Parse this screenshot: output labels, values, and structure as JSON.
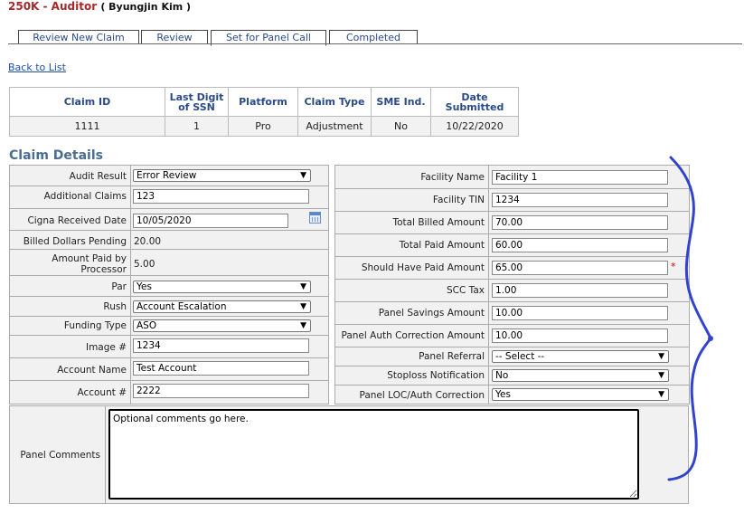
{
  "header": {
    "title": "250K - Auditor",
    "user": "( Byungjin Kim )"
  },
  "tabs": [
    "Review New Claim",
    "Review",
    "Set for Panel Call",
    "Completed"
  ],
  "back_link": "Back to List",
  "summary": {
    "headers": [
      "Claim ID",
      "Last Digit of SSN",
      "Platform",
      "Claim Type",
      "SME Ind.",
      "Date Submitted"
    ],
    "values": [
      "1111",
      "1",
      "Pro",
      "Adjustment",
      "No",
      "10/22/2020"
    ]
  },
  "section_title": "Claim Details",
  "left": {
    "audit_result": {
      "label": "Audit Result",
      "value": "Error Review"
    },
    "additional_claims": {
      "label": "Additional Claims",
      "value": "123"
    },
    "cigna_received": {
      "label": "Cigna Received Date",
      "value": "10/05/2020"
    },
    "billed_pending": {
      "label": "Billed Dollars Pending",
      "value": "20.00"
    },
    "amount_paid": {
      "label": "Amount Paid by Processor",
      "value": "5.00"
    },
    "par": {
      "label": "Par",
      "value": "Yes"
    },
    "rush": {
      "label": "Rush",
      "value": "Account Escalation"
    },
    "funding_type": {
      "label": "Funding Type",
      "value": "ASO"
    },
    "image_no": {
      "label": "Image #",
      "value": "1234"
    },
    "account_name": {
      "label": "Account Name",
      "value": "Test Account"
    },
    "account_no": {
      "label": "Account #",
      "value": "2222"
    }
  },
  "right": {
    "facility_name": {
      "label": "Facility Name",
      "value": "Facility 1"
    },
    "facility_tin": {
      "label": "Facility TIN",
      "value": "1234"
    },
    "total_billed": {
      "label": "Total Billed Amount",
      "value": "70.00"
    },
    "total_paid": {
      "label": "Total Paid Amount",
      "value": "60.00"
    },
    "should_have_paid": {
      "label": "Should Have Paid Amount",
      "value": "65.00",
      "required_mark": "*"
    },
    "scc_tax": {
      "label": "SCC Tax",
      "value": "1.00"
    },
    "panel_savings": {
      "label": "Panel Savings Amount",
      "value": "10.00"
    },
    "panel_auth_correction": {
      "label": "Panel Auth Correction Amount",
      "value": "10.00"
    },
    "panel_referral": {
      "label": "Panel Referral",
      "value": "-- Select --"
    },
    "stoploss": {
      "label": "Stoploss Notification",
      "value": "No"
    },
    "panel_loc": {
      "label": "Panel LOC/Auth Correction",
      "value": "Yes"
    }
  },
  "comments": {
    "label": "Panel Comments",
    "value": "Optional comments go here."
  },
  "colors": {
    "title": "#a52a2a",
    "link": "#1f4ea8",
    "section": "#4a6e91",
    "annotation": "#3344cc"
  }
}
